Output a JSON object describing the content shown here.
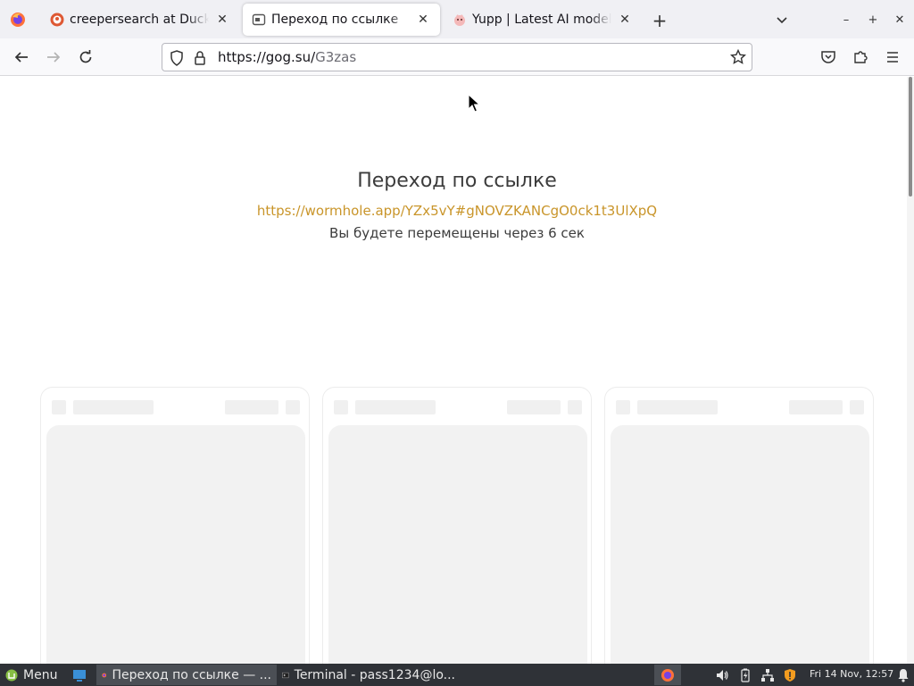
{
  "browser": {
    "tabs": [
      {
        "title": "creepersearch at DuckD",
        "icon": "duckduckgo-icon"
      },
      {
        "title": "Переход по ссылке",
        "icon": "page-icon",
        "active": true
      },
      {
        "title": "Yupp | Latest AI models",
        "icon": "yupp-icon"
      }
    ],
    "url_host": "https://gog.su/",
    "url_path": "G3zas"
  },
  "page": {
    "title": "Переход по ссылке",
    "link": "https://wormhole.app/YZx5vY#gNOVZKANCgO0ck1t3UlXpQ",
    "note": "Вы будете перемещены через 6 сек"
  },
  "taskbar": {
    "menu_label": "Menu",
    "windows": [
      {
        "label": "Переход по ссылке — ...",
        "icon": "firefox-icon",
        "active": true
      },
      {
        "label": "Terminal - pass1234@lo...",
        "icon": "terminal-icon",
        "active": false
      }
    ],
    "clock": "Fri 14 Nov, 12:57"
  },
  "colors": {
    "accent_link": "#c9952a",
    "tabstrip_bg": "#f0f0f4",
    "taskbar_bg": "#2f3237"
  }
}
